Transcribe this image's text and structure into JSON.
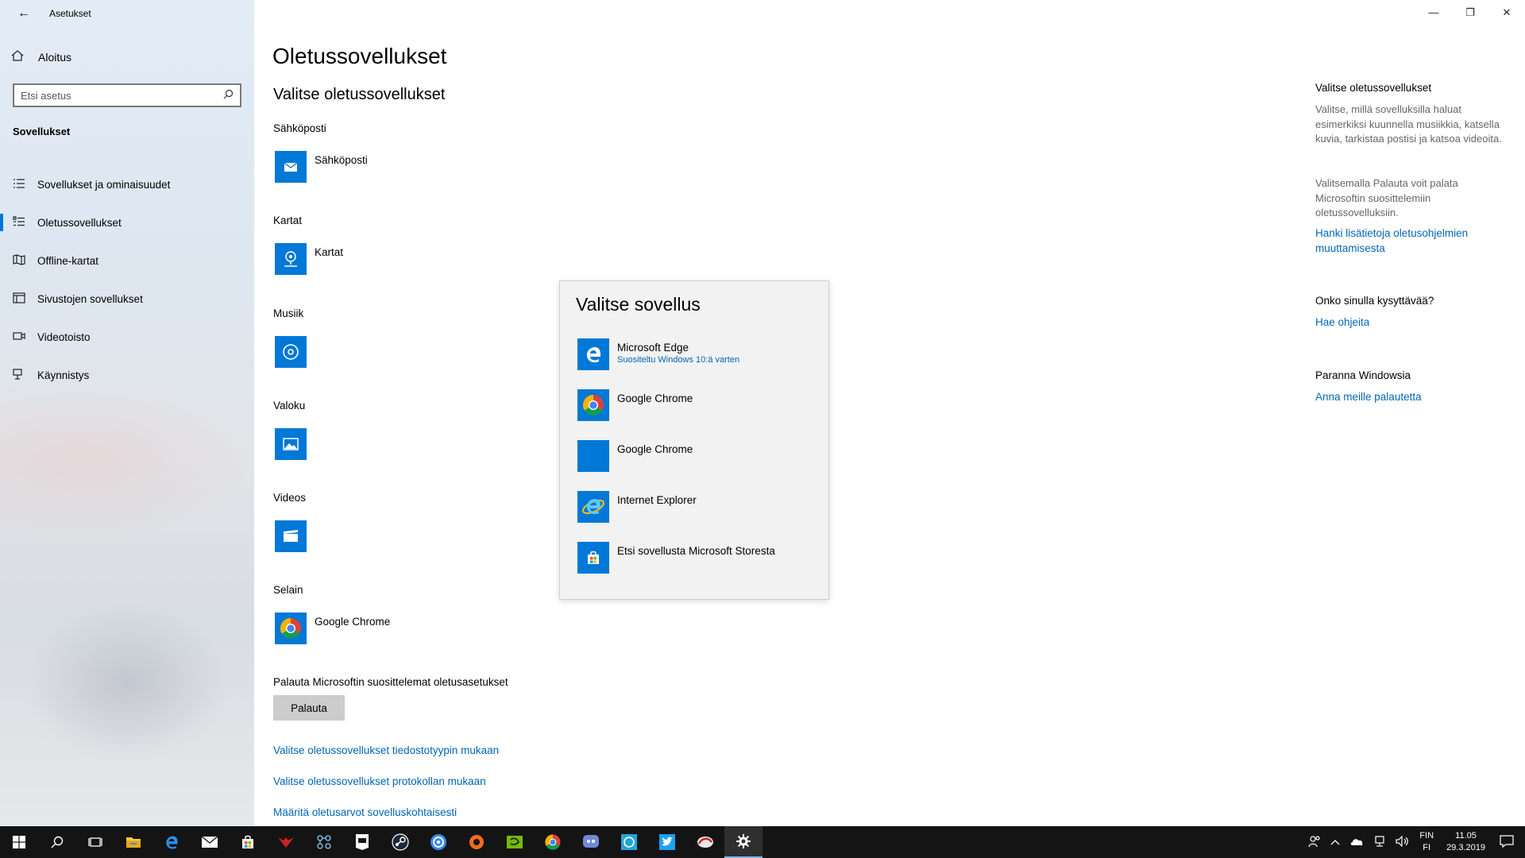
{
  "window": {
    "title": "Asetukset"
  },
  "sidebar": {
    "home_label": "Aloitus",
    "search_placeholder": "Etsi asetus",
    "section_title": "Sovellukset",
    "items": [
      {
        "label": "Sovellukset ja ominaisuudet",
        "icon": "list-icon"
      },
      {
        "label": "Oletussovellukset",
        "icon": "default-apps-icon",
        "selected": true
      },
      {
        "label": "Offline-kartat",
        "icon": "map-icon"
      },
      {
        "label": "Sivustojen sovellukset",
        "icon": "web-apps-icon"
      },
      {
        "label": "Videotoisto",
        "icon": "video-icon"
      },
      {
        "label": "Käynnistys",
        "icon": "startup-icon"
      }
    ]
  },
  "main": {
    "page_title": "Oletussovellukset",
    "subtitle": "Valitse oletussovellukset",
    "categories": [
      {
        "label": "Sähköposti",
        "app": "Sähköposti"
      },
      {
        "label": "Kartat",
        "app": "Kartat"
      },
      {
        "label": "Musiik",
        "app": ""
      },
      {
        "label": "Valoku",
        "app": ""
      },
      {
        "label": "Videos",
        "app": ""
      },
      {
        "label": "Selain",
        "app": "Google Chrome"
      }
    ],
    "reset_text": "Palauta Microsoftin suosittelemat oletusasetukset",
    "reset_button": "Palauta",
    "links": [
      "Valitse oletussovellukset tiedostotyypin mukaan",
      "Valitse oletussovellukset protokollan mukaan",
      "Määritä oletusarvot sovelluskohtaisesti"
    ]
  },
  "flyout": {
    "title": "Valitse sovellus",
    "items": [
      {
        "name": "Microsoft Edge",
        "sub": "Suositeltu Windows 10:ä varten"
      },
      {
        "name": "Google Chrome",
        "sub": ""
      },
      {
        "name": "Google Chrome",
        "sub": ""
      },
      {
        "name": "Internet Explorer",
        "sub": ""
      },
      {
        "name": "Etsi sovellusta Microsoft Storesta",
        "sub": ""
      }
    ]
  },
  "right_panel": {
    "heading1": "Valitse oletussovellukset",
    "text1": "Valitse, millä sovelluksilla haluat esimerkiksi kuunnella musiikkia, katsella kuvia, tarkistaa postisi ja katsoa videoita.",
    "text2": "Valitsemalla Palauta voit palata Microsoftin suosittelemiin oletussovelluksiin.",
    "link1": "Hanki lisätietoja oletusohjelmien muuttamisesta",
    "heading2": "Onko sinulla kysyttävää?",
    "link2": "Hae ohjeita",
    "heading3": "Paranna Windowsia",
    "link3": "Anna meille palautetta"
  },
  "taskbar": {
    "lang_top": "FIN",
    "lang_bottom": "FI",
    "time": "11.05",
    "date": "29.3.2019"
  },
  "colors": {
    "accent": "#0078d7",
    "link": "#0066b4",
    "taskbar": "#141414"
  }
}
